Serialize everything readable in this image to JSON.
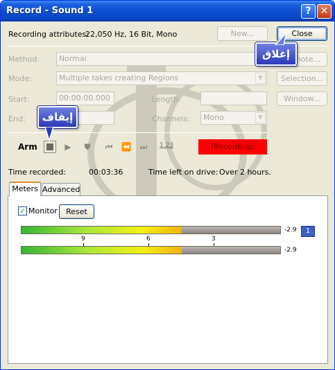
{
  "window": {
    "title": "Record - Sound 1"
  },
  "titlebar_buttons": {
    "help": "?",
    "close": "✕"
  },
  "attributes": {
    "label": "Recording attributes:",
    "value": "22,050 Hz, 16 Bit, Mono"
  },
  "buttons": {
    "new": "New...",
    "close": "Close",
    "remote": "Remote...",
    "selection": "Selection...",
    "window": "Window...",
    "reset": "Reset"
  },
  "form": {
    "method_label": "Method:",
    "method_value": "Normal",
    "mode_label": "Mode:",
    "mode_value": "Multiple takes creating Regions",
    "start_label": "Start:",
    "start_value": "00:00:00.000",
    "end_label": "End:",
    "end_value": "",
    "length_label": "Length:",
    "length_value": "",
    "channels_label": "Channels:",
    "channels_value": "Mono"
  },
  "transport": {
    "arm_label": "Arm",
    "counter_label": "1.23",
    "status_text": "[Recording]",
    "status_color": "#ff0000",
    "icons": [
      "stop-icon",
      "play-icon",
      "marker-icon",
      "go-to-start-icon",
      "rewind-icon",
      "go-to-end-icon"
    ]
  },
  "time": {
    "recorded_label": "Time recorded:",
    "recorded_value": "00:03:36",
    "left_label": "Time left on drive:",
    "left_value": "Over 2 hours."
  },
  "tabs": [
    {
      "label": "Meters",
      "active": true
    },
    {
      "label": "Advanced",
      "active": false
    }
  ],
  "meters": {
    "monitor_label": "Monitor",
    "monitor_checked": true,
    "check_mark": "✓",
    "peak_values": [
      "-2.9",
      "-2.9"
    ],
    "level_fraction": 0.62,
    "scale_labels": [
      "9",
      "6",
      "3"
    ],
    "channel_badge": "1"
  },
  "callouts": {
    "close_ar": "إغلاق",
    "stop_ar": "إيقاف"
  }
}
